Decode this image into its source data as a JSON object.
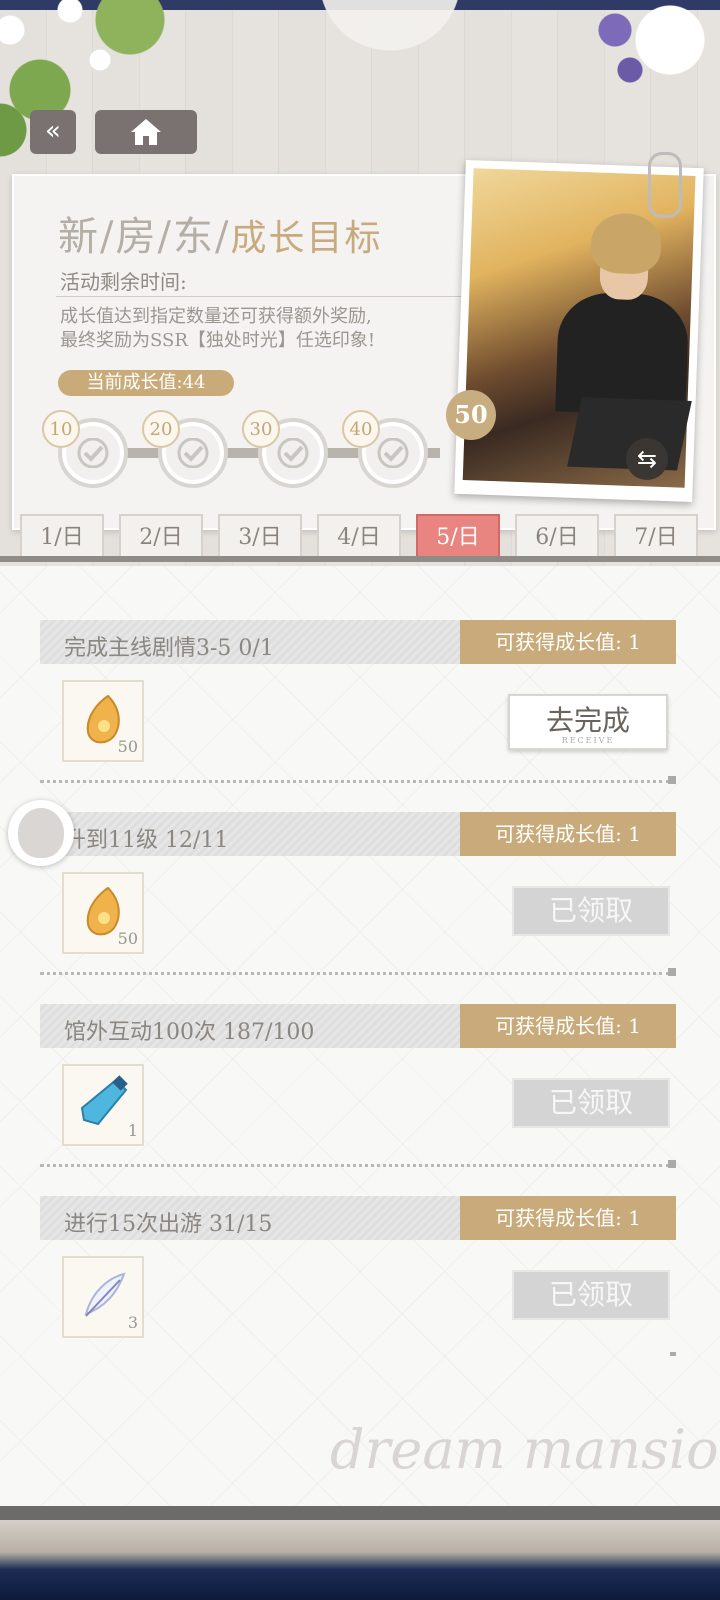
{
  "header": {
    "title_main": "新/房/东/",
    "title_accent": "成长目标",
    "remaining_label": "活动剩余时间:",
    "desc_line1": "成长值达到指定数量还可获得额外奖励,",
    "desc_line2": "最终奖励为SSR【独处时光】任选印象!",
    "current_growth": "当前成长值:44",
    "milestones": [
      "10",
      "20",
      "30",
      "40"
    ],
    "final_milestone": "50"
  },
  "tabs": [
    "1/日",
    "2/日",
    "3/日",
    "4/日",
    "5/日",
    "6/日",
    "7/日"
  ],
  "active_tab_index": 4,
  "tasks": [
    {
      "name": "完成主线剧情3-5 0/1",
      "reward": "可获得成长值: 1",
      "item_qty": "50",
      "item_icon": "amber-stone-icon",
      "button": "去完成",
      "button_sub": "RECEIVE",
      "state": "go"
    },
    {
      "name": "升到11级 12/11",
      "reward": "可获得成长值: 1",
      "item_qty": "50",
      "item_icon": "amber-stone-icon",
      "button": "已领取",
      "state": "done"
    },
    {
      "name": "馆外互动100次 187/100",
      "reward": "可获得成长值: 1",
      "item_qty": "1",
      "item_icon": "blue-tube-icon",
      "button": "已领取",
      "state": "done"
    },
    {
      "name": "进行15次出游 31/15",
      "reward": "可获得成长值: 1",
      "item_qty": "3",
      "item_icon": "feather-icon",
      "button": "已领取",
      "state": "done"
    }
  ],
  "watermark": "dream mansion",
  "colors": {
    "accent_gold": "#c9ab7b",
    "active_tab": "#e88581",
    "panel_bg": "#f8f8f7"
  }
}
